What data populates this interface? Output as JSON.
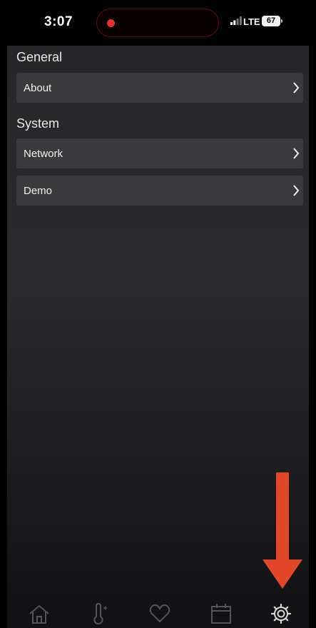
{
  "status_bar": {
    "time": "3:07",
    "network": "LTE",
    "battery": "67"
  },
  "sections": [
    {
      "title": "General",
      "items": [
        {
          "label": "About"
        }
      ]
    },
    {
      "title": "System",
      "items": [
        {
          "label": "Network"
        },
        {
          "label": "Demo"
        }
      ]
    }
  ],
  "tab_bar": {
    "tabs": [
      {
        "icon": "home-icon"
      },
      {
        "icon": "thermometer-icon"
      },
      {
        "icon": "heart-icon"
      },
      {
        "icon": "calendar-icon"
      },
      {
        "icon": "gear-icon"
      }
    ],
    "active_tab": "settings"
  },
  "annotation": {
    "icon": "down-arrow-icon",
    "color": "#e2472a"
  },
  "colors": {
    "background": "#2a2a2c",
    "row": "#3a3a3c",
    "tab_inactive": "#555557",
    "tab_active": "#d8d8d8"
  }
}
